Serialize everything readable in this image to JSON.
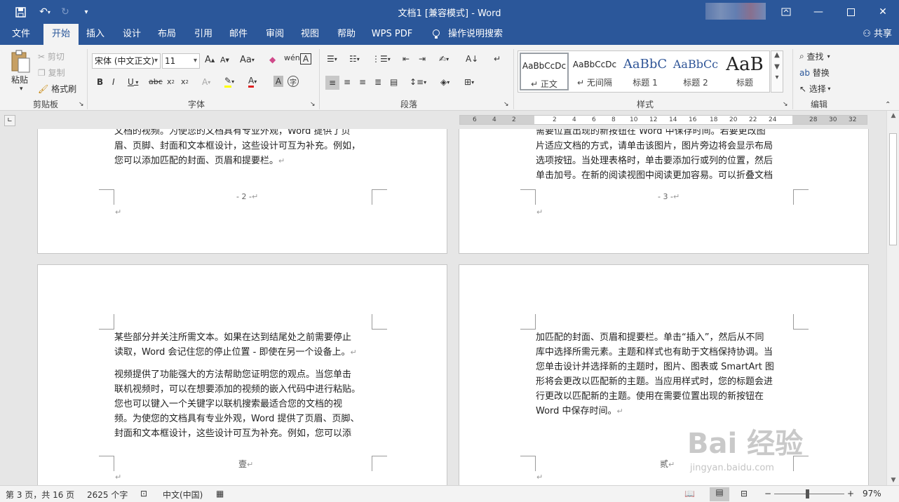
{
  "window": {
    "title": "文档1 [兼容模式] - Word",
    "minimize_icon": "minimize-icon",
    "maximize_icon": "maximize-icon",
    "close_icon": "close-icon"
  },
  "quick_access": [
    "save-icon",
    "undo-icon",
    "redo-icon",
    "customize-icon"
  ],
  "tabs": [
    {
      "label": "文件"
    },
    {
      "label": "开始"
    },
    {
      "label": "插入"
    },
    {
      "label": "设计"
    },
    {
      "label": "布局"
    },
    {
      "label": "引用"
    },
    {
      "label": "邮件"
    },
    {
      "label": "审阅"
    },
    {
      "label": "视图"
    },
    {
      "label": "帮助"
    },
    {
      "label": "WPS PDF"
    }
  ],
  "tell_me": "操作说明搜索",
  "share": "共享",
  "clipboard": {
    "paste": "粘贴",
    "cut": "剪切",
    "copy": "复制",
    "format_painter": "格式刷",
    "label": "剪贴板"
  },
  "font": {
    "name": "宋体 (中文正文)",
    "size": "11",
    "label": "字体"
  },
  "paragraph": {
    "label": "段落"
  },
  "styles": {
    "label": "样式",
    "items": [
      {
        "preview": "AaBbCcDc",
        "name": "正文"
      },
      {
        "preview": "AaBbCcDc",
        "name": "无间隔"
      },
      {
        "preview": "AaBbC",
        "name": "标题 1"
      },
      {
        "preview": "AaBbCc",
        "name": "标题 2"
      },
      {
        "preview": "AaB",
        "name": "标题"
      }
    ]
  },
  "editing": {
    "find": "查找",
    "replace": "替换",
    "select": "选择",
    "label": "编辑"
  },
  "ruler_ticks": [
    "6",
    "4",
    "2",
    "2",
    "4",
    "6",
    "8",
    "10",
    "12",
    "14",
    "16",
    "18",
    "20",
    "22",
    "24",
    "28",
    "30",
    "32"
  ],
  "pages": {
    "top_left": {
      "lines": [
        "文档的视频。为使您的文档具有专业外观，Word 提供了页",
        "眉、页脚、封面和文本框设计，这些设计可互为补充。例如，",
        "您可以添加匹配的封面、页眉和提要栏。"
      ],
      "page_number": "- 2 -"
    },
    "top_right": {
      "lines": [
        "需要位置出现的新按钮在 Word 中保存时间。若要更改图",
        "片适应文档的方式，请单击该图片，图片旁边将会显示布局",
        "选项按钮。当处理表格时，单击要添加行或列的位置，然后",
        "单击加号。在新的阅读视图中阅读更加容易。可以折叠文档"
      ],
      "page_number": "- 3 -"
    },
    "bottom_left": {
      "para1": [
        "某些部分并关注所需文本。如果在达到结尾处之前需要停止",
        "读取，Word 会记住您的停止位置 - 即使在另一个设备上。"
      ],
      "para2": [
        "视频提供了功能强大的方法帮助您证明您的观点。当您单击",
        "联机视频时，可以在想要添加的视频的嵌入代码中进行粘贴。",
        "您也可以键入一个关键字以联机搜索最适合您的文档的视",
        "频。为使您的文档具有专业外观，Word 提供了页眉、页脚、",
        "封面和文本框设计，这些设计可互为补充。例如，您可以添"
      ],
      "page_number": "壹"
    },
    "bottom_right": {
      "lines": [
        "加匹配的封面、页眉和提要栏。单击“插入”，然后从不同",
        "库中选择所需元素。主题和样式也有助于文档保持协调。当",
        "您单击设计并选择新的主题时，图片、图表或 SmartArt 图",
        "形将会更改以匹配新的主题。当应用样式时，您的标题会进",
        "行更改以匹配新的主题。使用在需要位置出现的新按钮在",
        "Word 中保存时间。"
      ],
      "page_number": "贰"
    }
  },
  "paragraph_mark": "↵",
  "status": {
    "page": "第 3 页，共 16 页",
    "words": "2625 个字",
    "language": "中文(中国)",
    "zoom": "97%"
  },
  "watermark": {
    "text": "Bai 经验",
    "sub": "jingyan.baidu.com"
  }
}
